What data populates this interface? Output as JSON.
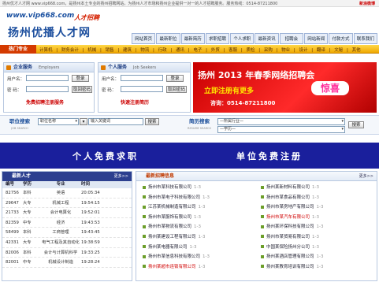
{
  "topbar": {
    "left_text": "扬州优才人才网 www.vip668.com，是扬州本土专业的扬州招聘网站，为扬州人才市场和扬州企业提供一对一的人才招聘服务。服务热线：0514-87211800",
    "right_text": "新浪微博"
  },
  "logo": {
    "url": "www.vip668.com",
    "tagline": "人才招聘",
    "name": "扬州优播人才网"
  },
  "nav": {
    "items": [
      "网站首页",
      "最新职位",
      "最新简历",
      "求职招聘",
      "个人求职",
      "最新资讯",
      "招聘会",
      "网站新闻",
      "付款方式",
      "联系我们"
    ]
  },
  "subnav": {
    "hot_label": "热门专业",
    "items": [
      "计算机",
      "财务会计",
      "机械",
      "销售",
      "建筑",
      "物流",
      "行政",
      "通讯",
      "电子",
      "外贸",
      "客服",
      "质检",
      "采购",
      "物业",
      "设计",
      "翻译",
      "文秘",
      "其他"
    ]
  },
  "employer_box": {
    "title": "企业服务",
    "title_en": "Employers",
    "user_label": "用户名：",
    "pass_label": "密 码：",
    "login_btn": "登录",
    "getpass_btn": "取回密码",
    "register_link": "免费招聘注册服务"
  },
  "seeker_box": {
    "title": "个人服务",
    "title_en": "Job Seekers",
    "user_label": "用户名：",
    "pass_label": "密 码：",
    "login_btn": "登录",
    "getpass_btn": "取回密码",
    "register_link": "快速注册简历"
  },
  "banner": {
    "line1": "扬州 2013 年春季网络招聘会",
    "line2": "立即注册有更多",
    "surprise": "惊喜",
    "tel": "咨询：0514-87211800"
  },
  "job_search": {
    "label": "职位搜索",
    "label_en": "JOB SEARCH",
    "select_value": "职位名称",
    "keyword_placeholder": "输入关键词",
    "button": "搜索"
  },
  "resume_search": {
    "label": "简历搜索",
    "label_en": "RESUME SEARCH",
    "select1": "—所属行业—",
    "select2": "—学历—",
    "button": "搜索"
  },
  "promo": {
    "left": "个人免费求职",
    "right": "单位免费注册"
  },
  "talent_panel": {
    "title": "最新人才",
    "more": "更多>>",
    "headers": [
      "编号",
      "学历",
      "专业",
      "时间"
    ],
    "rows": [
      [
        "82756",
        "本科",
        "英语",
        "20:05:34"
      ],
      [
        "29647",
        "大专",
        "机械工程",
        "19:54:15"
      ],
      [
        "21733",
        "大专",
        "会计电算化",
        "19:52:01"
      ],
      [
        "82359",
        "中专",
        "经济",
        "19:43:53"
      ],
      [
        "58499",
        "本科",
        "工商管理",
        "19:43:45"
      ],
      [
        "42331",
        "大专",
        "电气工程及其自动化",
        "19:38:59"
      ],
      [
        "82006",
        "本科",
        "会计与计算机科学",
        "19:33:25"
      ],
      [
        "82001",
        "中专",
        "机械设计制造",
        "19:28:24"
      ]
    ]
  },
  "company_panel": {
    "title": "最新招聘信息",
    "more": "更多>>",
    "left": [
      {
        "name": "扬州市某科技有限公司",
        "date": "1-3",
        "red": false
      },
      {
        "name": "扬州市某电子科技有限公司",
        "date": "1-3",
        "red": false
      },
      {
        "name": "江苏某机械制造有限公司",
        "date": "1-3",
        "red": false
      },
      {
        "name": "扬州市某服饰有限公司",
        "date": "1-3",
        "red": false
      },
      {
        "name": "扬州市某物流有限公司",
        "date": "1-3",
        "red": false
      },
      {
        "name": "扬州某建设工程有限公司",
        "date": "1-3",
        "red": false
      },
      {
        "name": "扬州某电器有限公司",
        "date": "1-3",
        "red": false
      },
      {
        "name": "扬州市某信息科技有限公司",
        "date": "1-3",
        "red": false
      },
      {
        "name": "扬州某超市连锁有限公司",
        "date": "1-3",
        "red": true
      }
    ],
    "right": [
      {
        "name": "扬州某新材料有限公司",
        "date": "1-3",
        "red": false
      },
      {
        "name": "扬州市某食品有限公司",
        "date": "1-3",
        "red": false
      },
      {
        "name": "扬州市某房地产有限公司",
        "date": "1-3",
        "red": false
      },
      {
        "name": "扬州市某汽车有限公司",
        "date": "1-3",
        "red": true
      },
      {
        "name": "扬州某环保科技有限公司",
        "date": "1-3",
        "red": false
      },
      {
        "name": "扬州市某贸易有限公司",
        "date": "1-3",
        "red": false
      },
      {
        "name": "中国某保险扬州分公司",
        "date": "1-3",
        "red": false
      },
      {
        "name": "扬州某酒店管理有限公司",
        "date": "1-3",
        "red": false
      },
      {
        "name": "扬州某教育培训有限公司",
        "date": "1-3",
        "red": false
      }
    ]
  }
}
